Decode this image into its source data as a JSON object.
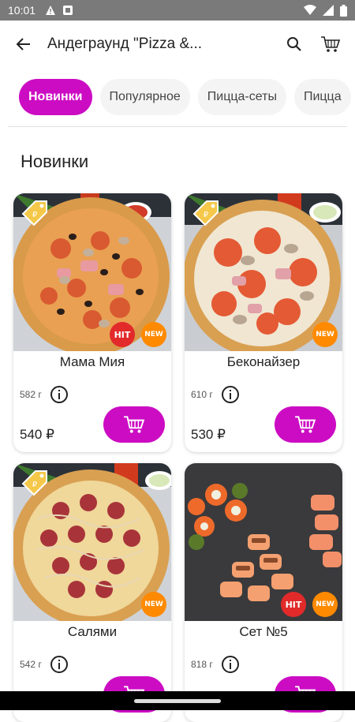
{
  "status": {
    "time": "10:01"
  },
  "header": {
    "title": "Андеграунд \"Pizza &..."
  },
  "categories": [
    "Новинки",
    "Популярное",
    "Пицца-сеты",
    "Пицца"
  ],
  "section": {
    "title": "Новинки"
  },
  "products": [
    {
      "name": "Мама Мия",
      "weight": "582 г",
      "price": "540 ₽",
      "badges": [
        "HIT",
        "NEW"
      ]
    },
    {
      "name": "Беконайзер",
      "weight": "610 г",
      "price": "530 ₽",
      "badges": [
        "NEW"
      ]
    },
    {
      "name": "Салями",
      "weight": "542 г",
      "price": "",
      "badges": [
        "NEW"
      ]
    },
    {
      "name": "Сет №5",
      "weight": "818 г",
      "price": "",
      "badges": [
        "HIT",
        "NEW"
      ]
    }
  ],
  "colors": {
    "accent": "#cc0cc3",
    "hit_badge": "#e22a2a",
    "new_badge": "#ff8a00",
    "status_bar": "#7a7a7a"
  }
}
